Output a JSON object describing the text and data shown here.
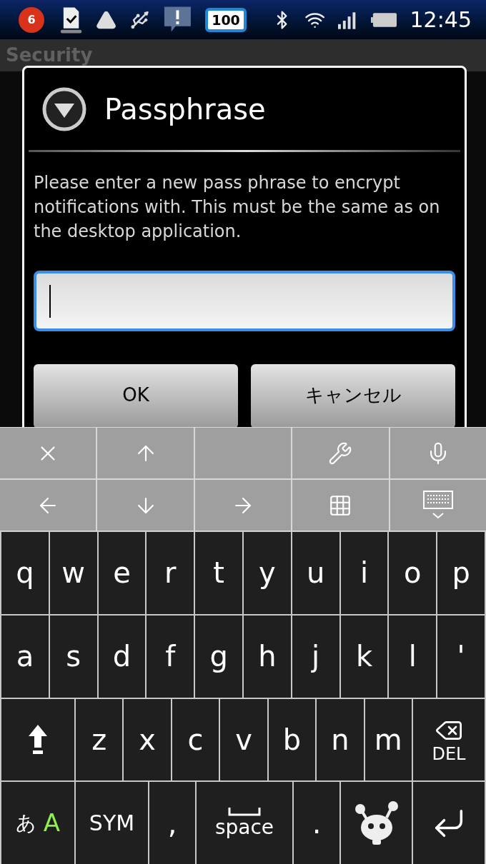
{
  "status_bar": {
    "notification_count": "6",
    "battery_badge": "100",
    "time": "12:45"
  },
  "screen": {
    "title": "Security"
  },
  "dialog": {
    "title": "Passphrase",
    "message": "Please enter a new pass phrase to encrypt notifications with. This must be the same as on the desktop application.",
    "input": {
      "focused": true
    },
    "buttons": [
      {
        "label": "OK"
      },
      {
        "label": "キャンセル"
      }
    ]
  },
  "keyboard": {
    "rows": [
      {
        "keys": [
          {
            "kind": "char",
            "label": "q"
          },
          {
            "kind": "char",
            "label": "w"
          },
          {
            "kind": "char",
            "label": "e"
          },
          {
            "kind": "char",
            "label": "r"
          },
          {
            "kind": "char",
            "label": "t"
          },
          {
            "kind": "char",
            "label": "y"
          },
          {
            "kind": "char",
            "label": "u"
          },
          {
            "kind": "char",
            "label": "i"
          },
          {
            "kind": "char",
            "label": "o"
          },
          {
            "kind": "char",
            "label": "p"
          }
        ]
      },
      {
        "keys": [
          {
            "kind": "char",
            "label": "a"
          },
          {
            "kind": "char",
            "label": "s"
          },
          {
            "kind": "char",
            "label": "d"
          },
          {
            "kind": "char",
            "label": "f"
          },
          {
            "kind": "char",
            "label": "g"
          },
          {
            "kind": "char",
            "label": "h"
          },
          {
            "kind": "char",
            "label": "j"
          },
          {
            "kind": "char",
            "label": "k"
          },
          {
            "kind": "char",
            "label": "l"
          },
          {
            "kind": "char",
            "label": "'"
          }
        ]
      },
      {
        "keys": [
          {
            "kind": "shift"
          },
          {
            "kind": "char",
            "label": "z"
          },
          {
            "kind": "char",
            "label": "x"
          },
          {
            "kind": "char",
            "label": "c"
          },
          {
            "kind": "char",
            "label": "v"
          },
          {
            "kind": "char",
            "label": "b"
          },
          {
            "kind": "char",
            "label": "n"
          },
          {
            "kind": "char",
            "label": "m"
          },
          {
            "kind": "del",
            "label": "DEL"
          }
        ]
      },
      {
        "keys": [
          {
            "kind": "mode",
            "label": "あ",
            "alt_label": "A"
          },
          {
            "kind": "sym",
            "label": "SYM"
          },
          {
            "kind": "char",
            "label": ","
          },
          {
            "kind": "space",
            "label": "space"
          },
          {
            "kind": "char",
            "label": "."
          },
          {
            "kind": "mascot"
          },
          {
            "kind": "enter"
          }
        ]
      }
    ]
  }
}
